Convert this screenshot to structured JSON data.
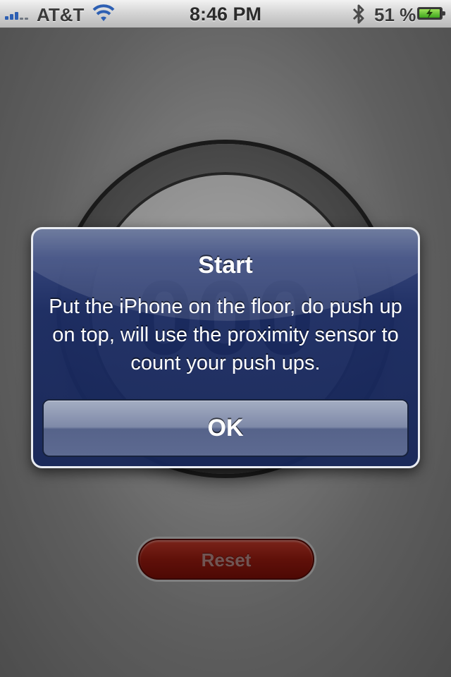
{
  "status_bar": {
    "carrier": "AT&T",
    "time": "8:46 PM",
    "battery_percent": "51 %",
    "signal_bars_filled": 3,
    "icons": [
      "signal-icon",
      "wifi-icon",
      "bluetooth-icon",
      "battery-charging-icon"
    ]
  },
  "counter": {
    "value": "000"
  },
  "reset_button": {
    "label": "Reset"
  },
  "alert": {
    "title": "Start",
    "message": "Put the iPhone on the floor, do push up on top, will use the proximity sensor to count your push ups.",
    "ok_label": "OK"
  },
  "colors": {
    "alert_background": "#1b2c64",
    "reset_button": "#9b1b10",
    "battery_fill": "#3ea51e",
    "signal": "#2d5fb3"
  }
}
